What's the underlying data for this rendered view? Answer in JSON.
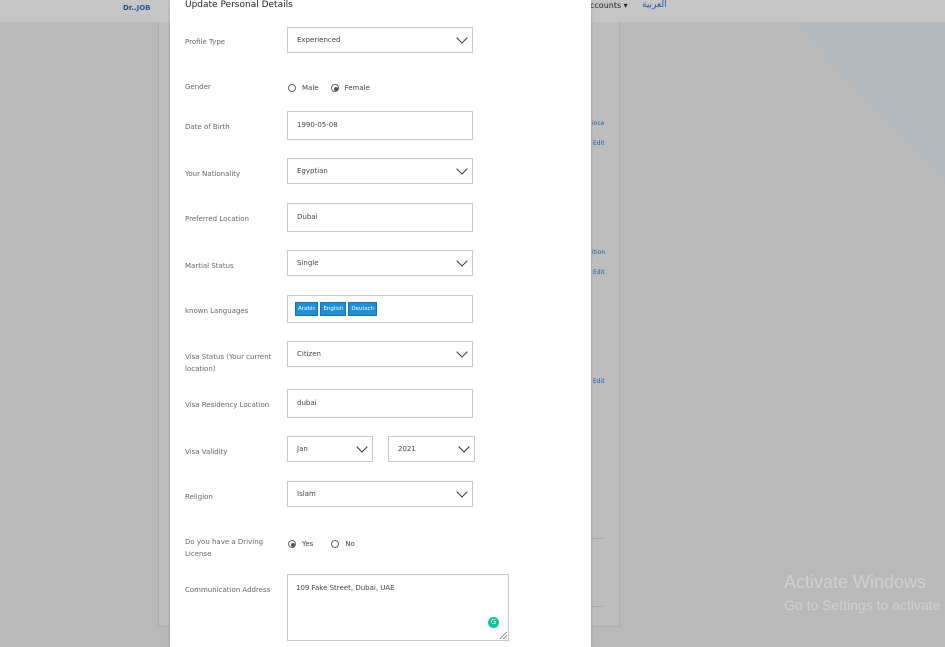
{
  "background": {
    "logo_prefix": "Dr..",
    "logo_suffix": "JOB",
    "accounts_menu": "ccounts ▾",
    "language_link": "العربية",
    "side_links": [
      "ince",
      "Edit",
      "ition",
      "Edit",
      "Edit"
    ],
    "watermark_title": "Activate Windows",
    "watermark_subtitle": "Go to Settings to activate"
  },
  "modal": {
    "title": "Update Personal Details",
    "fields": {
      "profile_type": {
        "label": "Profile Type",
        "value": "Experienced"
      },
      "gender": {
        "label": "Gender",
        "options": [
          "Male",
          "Female"
        ],
        "selected": "Female"
      },
      "dob": {
        "label": "Date of Birth",
        "value": "1990-05-08"
      },
      "nationality": {
        "label": "Your Nationality",
        "value": "Egyptian"
      },
      "preferred_location": {
        "label": "Preferred Location",
        "value": "Dubai"
      },
      "marital_status": {
        "label": "Martial Status",
        "value": "Single"
      },
      "languages": {
        "label": "known Languages",
        "tags": [
          "Arabic",
          "English",
          "Deutsch"
        ]
      },
      "visa_status": {
        "label": "Visa Status (Your current location)",
        "value": "Citizen"
      },
      "visa_residency": {
        "label": "Visa Residency Location",
        "value": "dubai"
      },
      "visa_validity": {
        "label": "Visa Validity",
        "month": "Jan",
        "year": "2021"
      },
      "religion": {
        "label": "Religion",
        "value": "Islam"
      },
      "driving_license": {
        "label": "Do you have a Driving License",
        "options": [
          "Yes",
          "No"
        ],
        "selected": "Yes"
      },
      "address": {
        "label": "Communication Address",
        "value": "109 Fake Street, Dubai, UAE"
      }
    }
  }
}
